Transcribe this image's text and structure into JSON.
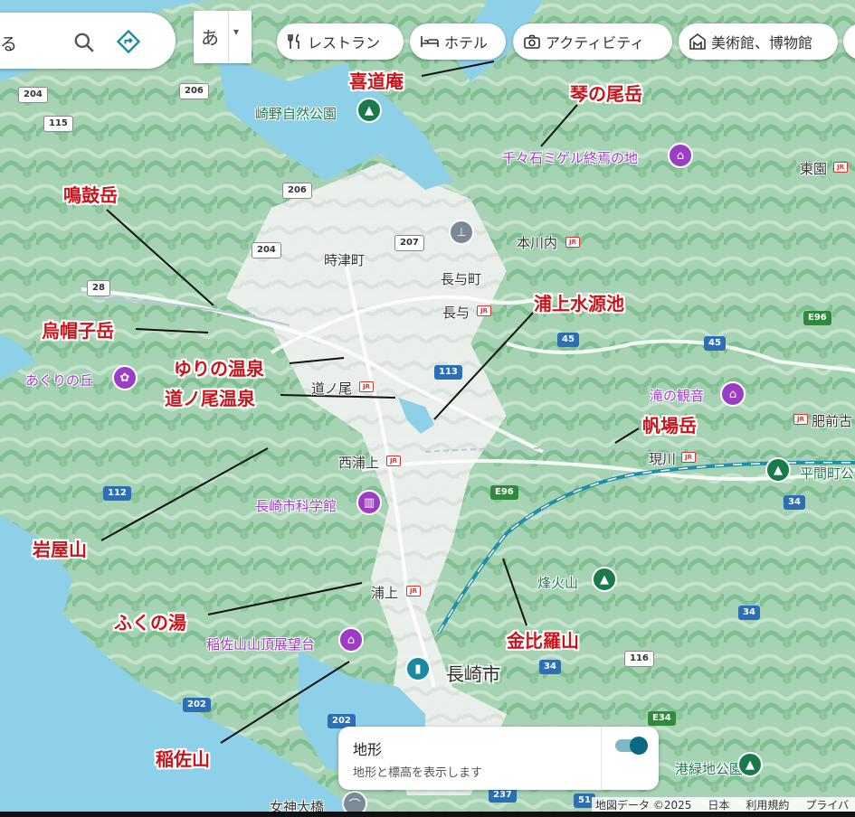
{
  "search": {
    "fragment": "る",
    "search_icon": "search-icon",
    "directions_icon": "directions-icon"
  },
  "language": {
    "current": "あ",
    "caret": "▾"
  },
  "chips": [
    {
      "label": "レストラン",
      "icon": "fork-knife-icon"
    },
    {
      "label": "ホテル",
      "icon": "bed-icon"
    },
    {
      "label": "アクティビティ",
      "icon": "camera-icon"
    },
    {
      "label": "美術館、博物館",
      "icon": "museum-icon"
    }
  ],
  "annotations": [
    "喜道庵",
    "琴の尾岳",
    "鳴鼓岳",
    "烏帽子岳",
    "ゆりの温泉",
    "道ノ尾温泉",
    "浦上水源池",
    "帆場岳",
    "岩屋山",
    "ふくの湯",
    "金比羅山",
    "稲佐山"
  ],
  "places": {
    "tokitsu": "時津町",
    "nagayo_town": "長与町",
    "nagayo": "長与",
    "motokawachi": "本川内",
    "higashizono": "東園",
    "michinoo": "道ノ尾",
    "nishiurakami": "西浦上",
    "urakami": "浦上",
    "genkawa": "現川",
    "hizen": "肥前古",
    "nagasaki_city": "長崎市"
  },
  "pois": {
    "sakino_park": "崎野自然公園",
    "chijiwa": "千々石ミゲル終焉の地",
    "aguri": "あぐりの丘",
    "taki_kannon": "滝の観音",
    "science_museum": "長崎市科学館",
    "inasayama_view": "稲佐山山頂展望台",
    "norosan": "烽火山",
    "hirama_park": "平間町公",
    "park_bottom": "港緑地公園",
    "megami": "女神大橋"
  },
  "routes": [
    "204",
    "206",
    "115",
    "206",
    "204",
    "28",
    "207",
    "113",
    "45",
    "45",
    "E96",
    "E96",
    "112",
    "34",
    "34",
    "116",
    "34",
    "202",
    "202",
    "237",
    "51",
    "E34"
  ],
  "terrain_panel": {
    "title": "地形",
    "subtitle": "地形と標高を表示します",
    "enabled": true
  },
  "footer": {
    "map_data": "地図データ ©2025",
    "region": "日本",
    "terms": "利用規約",
    "privacy": "プライバ"
  },
  "colors": {
    "water": "#8ed0e8",
    "land": "#eef0ea",
    "forest": "#9fd0ad",
    "annotation": "#c8151b",
    "poi": "#9b3ec4",
    "rail": "#1f8ea8"
  }
}
